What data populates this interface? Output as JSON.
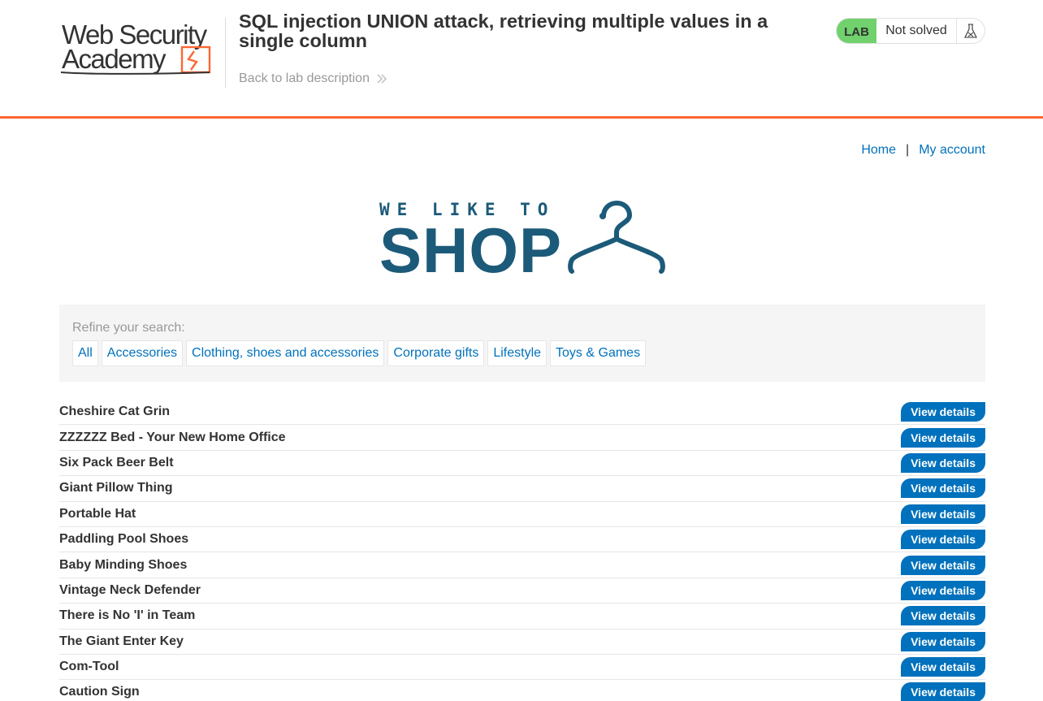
{
  "header": {
    "logo_line1": "Web Security",
    "logo_line2": "Academy",
    "lab_title": "SQL injection UNION attack, retrieving multiple values in a single column",
    "back_link": "Back to lab description",
    "lab_badge": "LAB",
    "lab_status": "Not solved",
    "colors": {
      "accent": "#ff6633",
      "solved_badge": "#70d16d",
      "link": "#0071bc"
    }
  },
  "nav": {
    "home": "Home",
    "separator": "|",
    "my_account": "My account"
  },
  "banner": {
    "line1": "WE LIKE TO",
    "line2": "SHOP",
    "icon": "hanger-icon"
  },
  "filter": {
    "label": "Refine your search:",
    "categories": [
      "All",
      "Accessories",
      "Clothing, shoes and accessories",
      "Corporate gifts",
      "Lifestyle",
      "Toys & Games"
    ]
  },
  "products": [
    {
      "name": "Cheshire Cat Grin",
      "action": "View details"
    },
    {
      "name": "ZZZZZZ Bed - Your New Home Office",
      "action": "View details"
    },
    {
      "name": "Six Pack Beer Belt",
      "action": "View details"
    },
    {
      "name": "Giant Pillow Thing",
      "action": "View details"
    },
    {
      "name": "Portable Hat",
      "action": "View details"
    },
    {
      "name": "Paddling Pool Shoes",
      "action": "View details"
    },
    {
      "name": "Baby Minding Shoes",
      "action": "View details"
    },
    {
      "name": "Vintage Neck Defender",
      "action": "View details"
    },
    {
      "name": "There is No 'I' in Team",
      "action": "View details"
    },
    {
      "name": "The Giant Enter Key",
      "action": "View details"
    },
    {
      "name": "Com-Tool",
      "action": "View details"
    },
    {
      "name": "Caution Sign",
      "action": "View details"
    }
  ]
}
